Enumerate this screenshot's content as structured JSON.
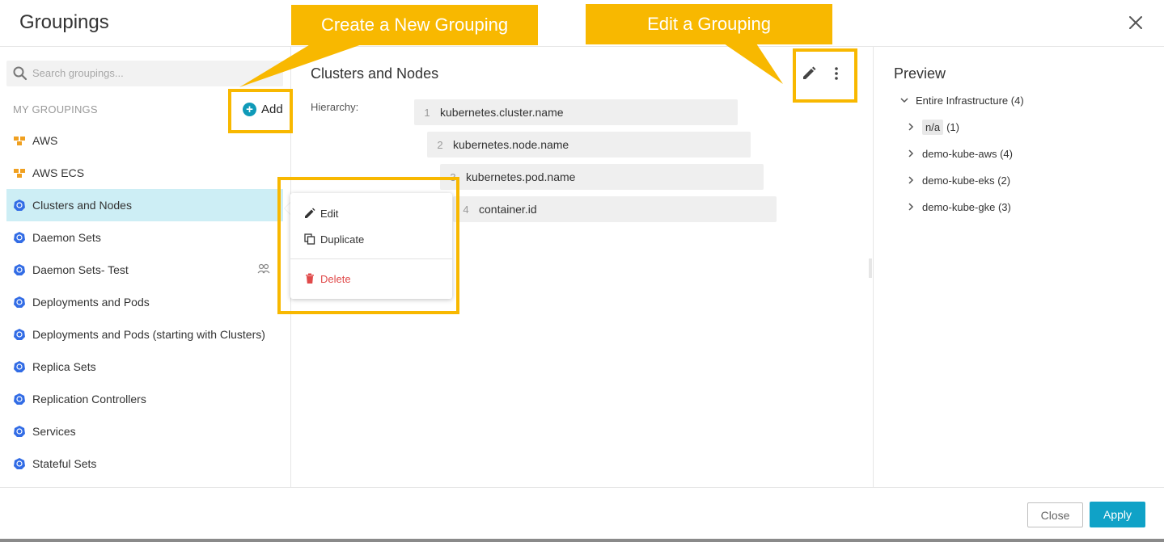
{
  "modal": {
    "title": "Groupings",
    "close_icon": "close-icon"
  },
  "sidebar": {
    "search_placeholder": "Search groupings...",
    "section_label": "MY GROUPINGS",
    "add_label": "Add",
    "items": [
      {
        "label": "AWS",
        "icon": "aws-icon",
        "selected": false
      },
      {
        "label": "AWS ECS",
        "icon": "aws-icon",
        "selected": false
      },
      {
        "label": "Clusters and Nodes",
        "icon": "kubernetes-icon",
        "selected": true
      },
      {
        "label": "Daemon Sets",
        "icon": "kubernetes-icon",
        "selected": false
      },
      {
        "label": "Daemon Sets- Test",
        "icon": "kubernetes-icon",
        "selected": false,
        "shared": true
      },
      {
        "label": "Deployments and Pods",
        "icon": "kubernetes-icon",
        "selected": false
      },
      {
        "label": "Deployments and Pods (starting with Clusters)",
        "icon": "kubernetes-icon",
        "selected": false
      },
      {
        "label": "Replica Sets",
        "icon": "kubernetes-icon",
        "selected": false
      },
      {
        "label": "Replication Controllers",
        "icon": "kubernetes-icon",
        "selected": false
      },
      {
        "label": "Services",
        "icon": "kubernetes-icon",
        "selected": false
      },
      {
        "label": "Stateful Sets",
        "icon": "kubernetes-icon",
        "selected": false
      }
    ]
  },
  "detail": {
    "title": "Clusters and Nodes",
    "hierarchy_label": "Hierarchy:",
    "hierarchy": [
      {
        "num": "1",
        "name": "kubernetes.cluster.name"
      },
      {
        "num": "2",
        "name": "kubernetes.node.name"
      },
      {
        "num": "3",
        "name": "kubernetes.pod.name"
      },
      {
        "num": "4",
        "name": "container.id"
      }
    ]
  },
  "context_menu": {
    "edit_label": "Edit",
    "duplicate_label": "Duplicate",
    "delete_label": "Delete"
  },
  "preview": {
    "title": "Preview",
    "root": "Entire Infrastructure (4)",
    "children": [
      {
        "tag": "n/a",
        "count": "(1)"
      },
      {
        "label": "demo-kube-aws (4)"
      },
      {
        "label": "demo-kube-eks (2)"
      },
      {
        "label": "demo-kube-gke (3)"
      }
    ]
  },
  "footer": {
    "close_label": "Close",
    "apply_label": "Apply"
  },
  "annotations": {
    "create_callout": "Create a New Grouping",
    "edit_callout": "Edit a Grouping"
  },
  "colors": {
    "accent": "#10a2c7",
    "selected_row": "#cdeef5",
    "callout": "#f8b800",
    "danger": "#e04a4a",
    "aws_orange": "#f0a020",
    "kubernetes_blue": "#326ce5"
  }
}
